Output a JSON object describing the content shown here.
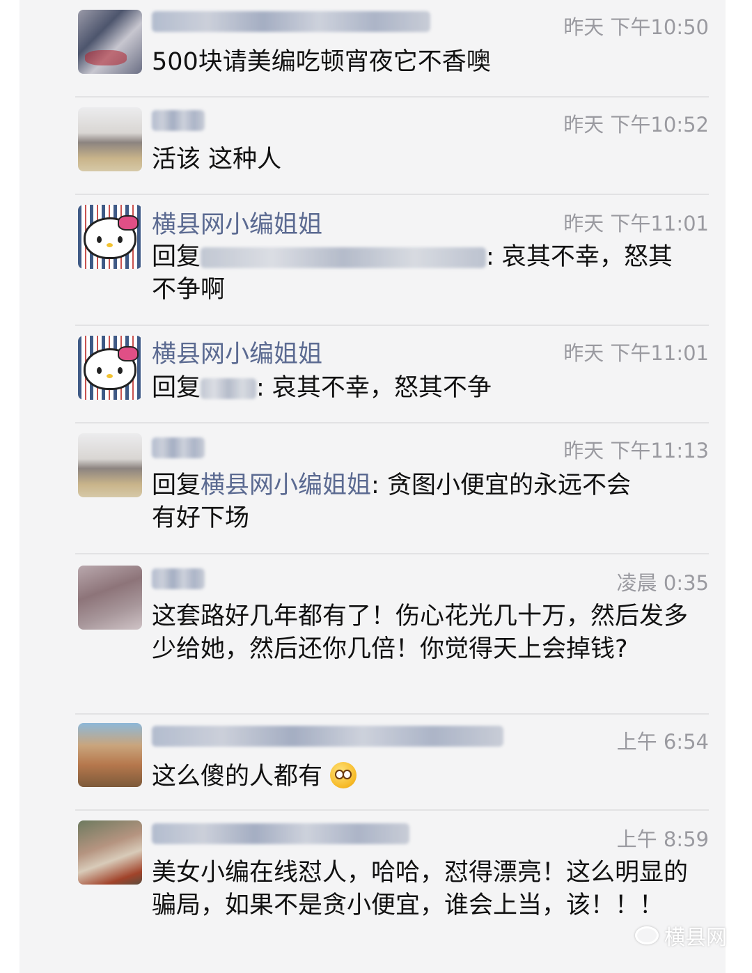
{
  "comments": [
    {
      "time": "昨天 下午10:50",
      "text": "500块请美编吃顿宵夜它不香噢"
    },
    {
      "time": "昨天 下午10:52",
      "text": "活该 这种人"
    },
    {
      "name": "横县网小编姐姐",
      "time": "昨天 下午11:01",
      "reply_prefix": "回复",
      "text_line1": ": 哀其不幸，怒其",
      "text_line2": "不争啊"
    },
    {
      "name": "横县网小编姐姐",
      "time": "昨天 下午11:01",
      "reply_prefix": "回复",
      "text": ": 哀其不幸，怒其不争"
    },
    {
      "time": "昨天 下午11:13",
      "reply_prefix": "回复",
      "reply_target": "横县网小编姐姐",
      "text_line1": ": 贪图小便宜的永远不会",
      "text_line2": "有好下场"
    },
    {
      "time": "凌晨 0:35",
      "text": "这套路好几年都有了！伤心花光几十万，然后发多少给她，然后还你几倍！你觉得天上会掉钱?"
    },
    {
      "time": "上午 6:54",
      "text": "这么傻的人都有",
      "emoji": "flushed-face-emoji"
    },
    {
      "time": "上午 8:59",
      "text": "美女小编在线怼人，哈哈，怼得漂亮！这么明显的骗局，如果不是贪小便宜，谁会上当，该！！！"
    }
  ],
  "watermark": {
    "icon": "wechat-icon",
    "text": "横县网"
  },
  "colors": {
    "name": "#5b6a91",
    "time": "#9a9aa0",
    "text": "#111111",
    "panel": "#f4f4f5",
    "divider": "#e2e2e4"
  }
}
